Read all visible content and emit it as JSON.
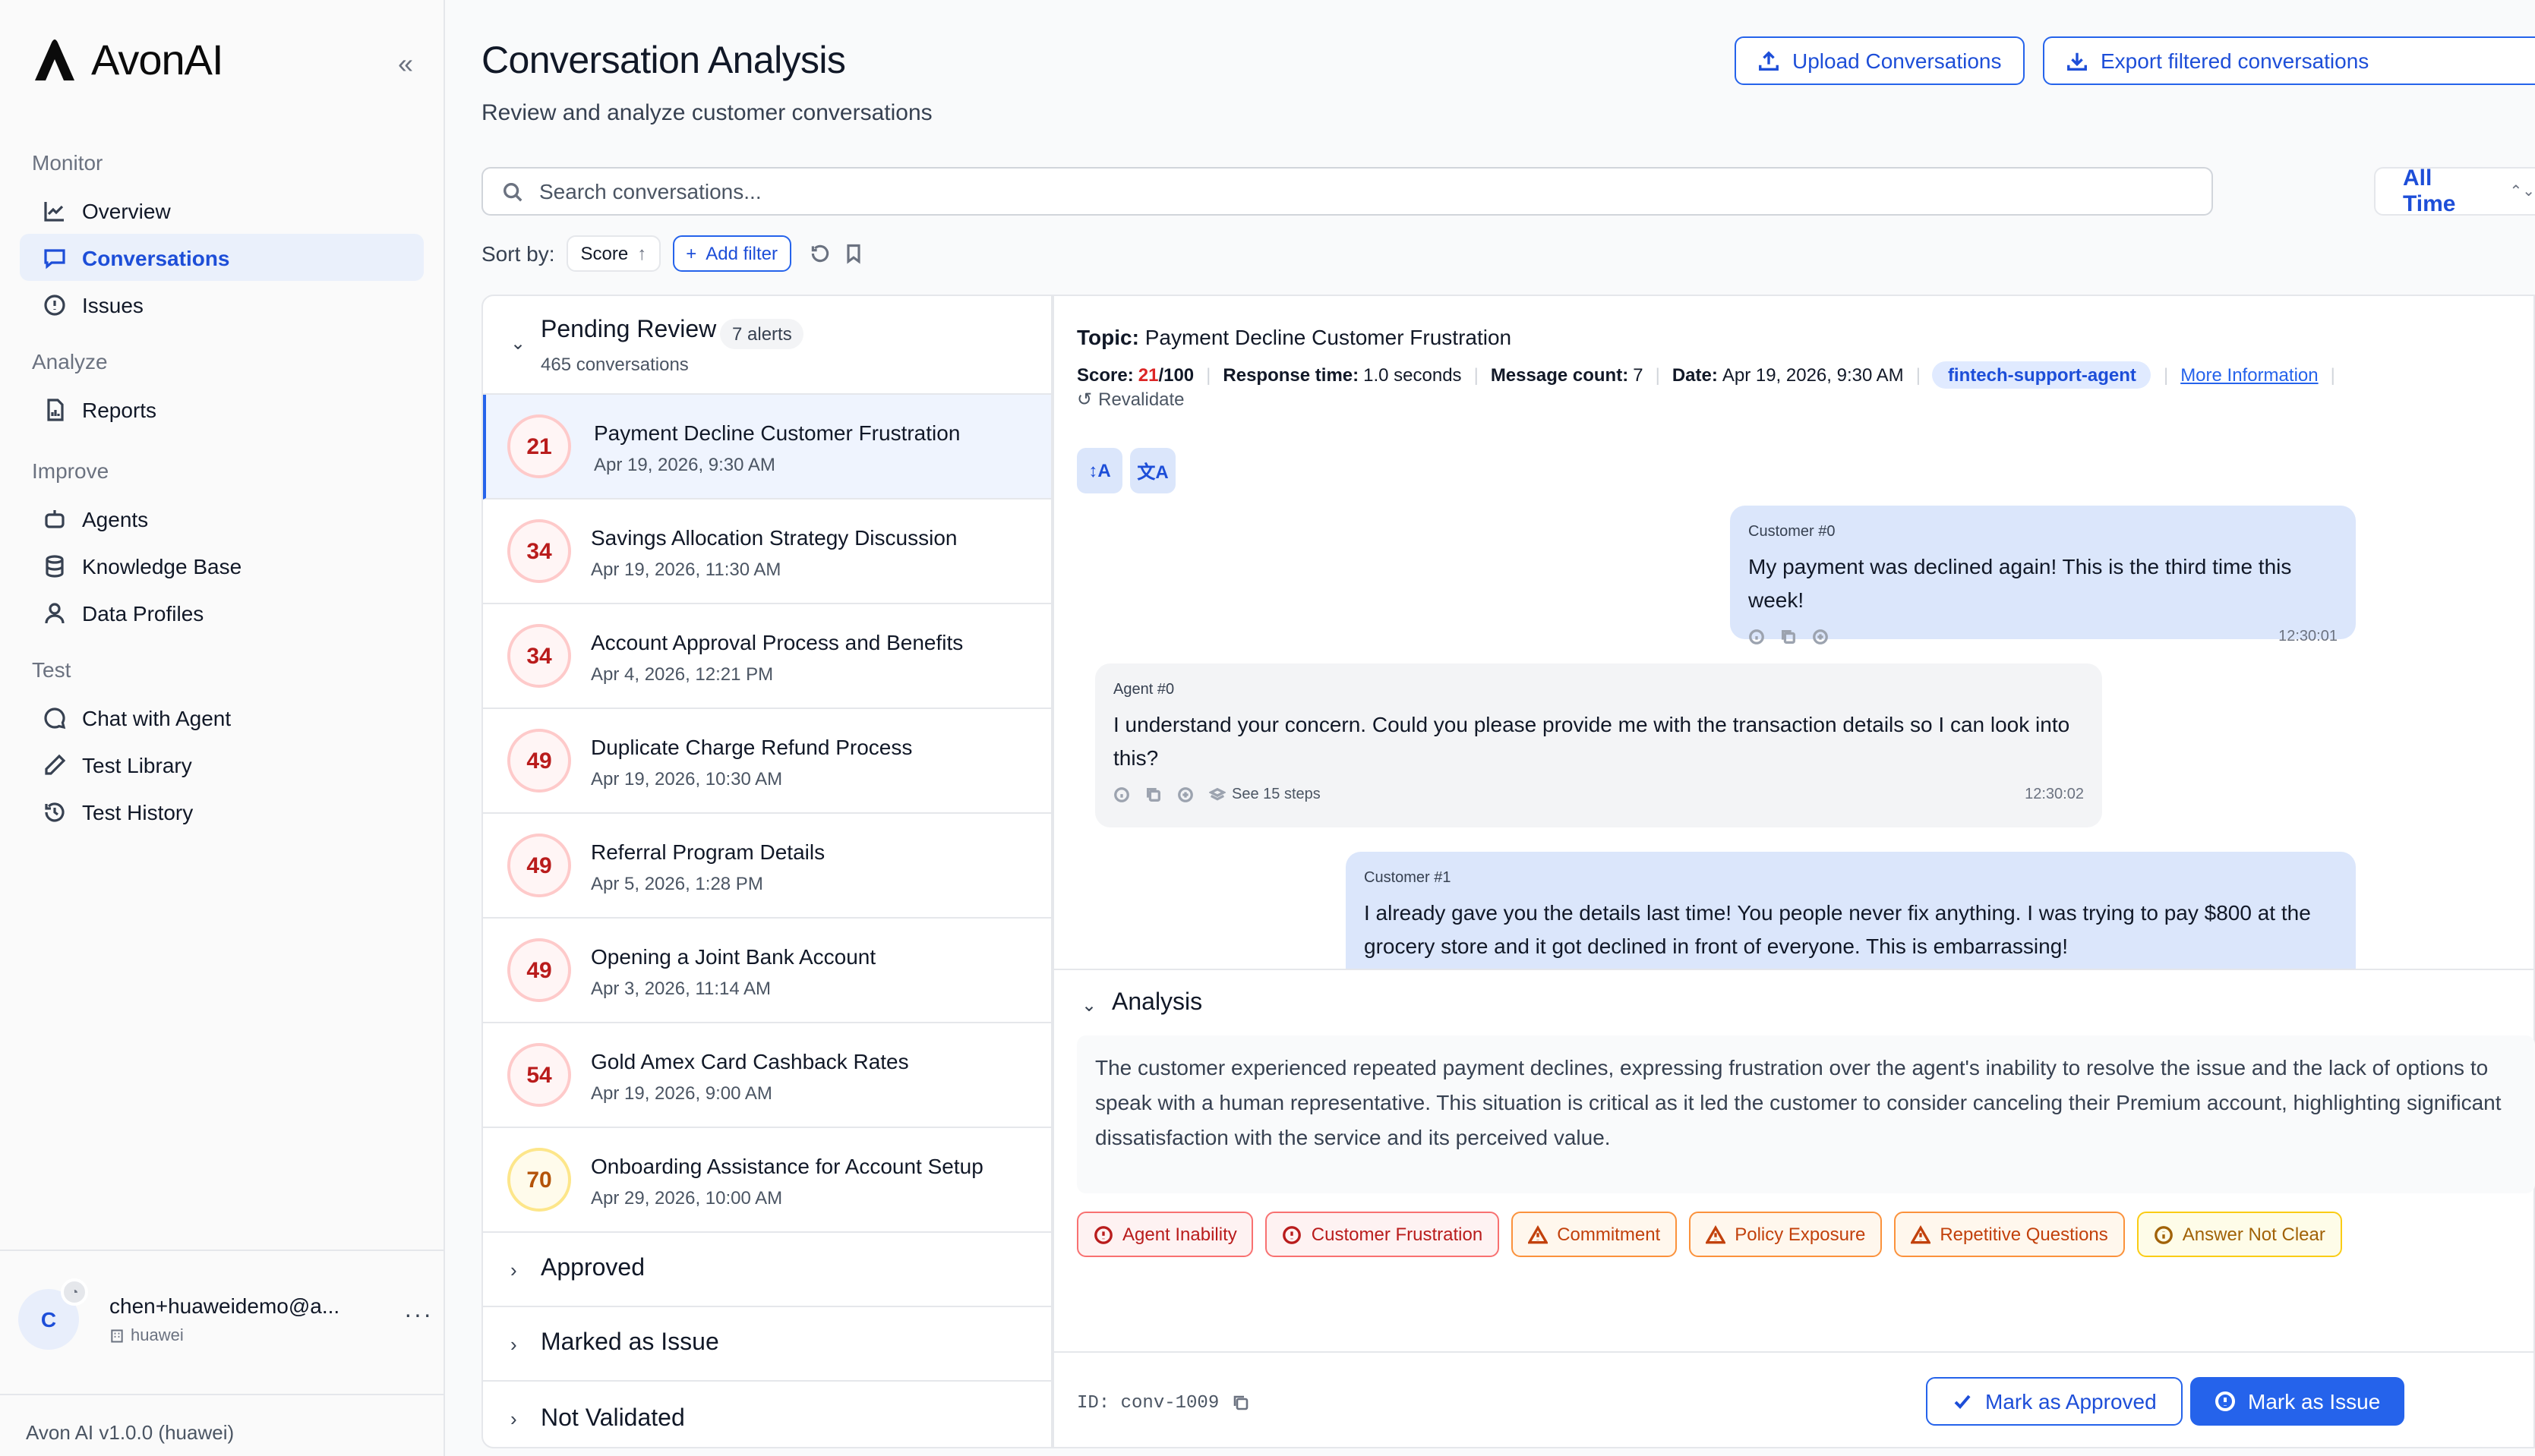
{
  "brand": {
    "name": "AvonAI"
  },
  "sidebar": {
    "sections": [
      {
        "heading": "Monitor",
        "items": [
          {
            "label": "Overview",
            "icon": "chart-line-icon",
            "active": false
          },
          {
            "label": "Conversations",
            "icon": "message-square-icon",
            "active": true
          },
          {
            "label": "Issues",
            "icon": "alert-circle-icon",
            "active": false
          }
        ]
      },
      {
        "heading": "Analyze",
        "items": [
          {
            "label": "Reports",
            "icon": "file-chart-icon",
            "active": false
          }
        ]
      },
      {
        "heading": "Improve",
        "items": [
          {
            "label": "Agents",
            "icon": "bot-icon",
            "active": false
          },
          {
            "label": "Knowledge Base",
            "icon": "database-icon",
            "active": false
          },
          {
            "label": "Data Profiles",
            "icon": "user-icon",
            "active": false
          }
        ]
      },
      {
        "heading": "Test",
        "items": [
          {
            "label": "Chat with Agent",
            "icon": "chat-bubble-icon",
            "active": false
          },
          {
            "label": "Test Library",
            "icon": "pencil-icon",
            "active": false
          },
          {
            "label": "Test History",
            "icon": "history-icon",
            "active": false
          }
        ]
      }
    ],
    "user": {
      "initial": "C",
      "email": "chen+huaweidemo@a...",
      "org": "huawei"
    },
    "version": "Avon AI v1.0.0 (huawei)"
  },
  "header": {
    "title": "Conversation Analysis",
    "subtitle": "Review and analyze customer conversations",
    "upload_label": "Upload Conversations",
    "export_label": "Export filtered conversations"
  },
  "search": {
    "placeholder": "Search conversations...",
    "value": ""
  },
  "time_filter": {
    "selected": "All Time"
  },
  "sort": {
    "label": "Sort by:",
    "field": "Score",
    "add_filter_label": "Add filter"
  },
  "list": {
    "pending": {
      "title": "Pending Review",
      "alerts": "7 alerts",
      "count": "465 conversations"
    },
    "rows": [
      {
        "score": "21",
        "title": "Payment Decline Customer Frustration",
        "date": "Apr 19, 2026, 9:30 AM",
        "tone": "red",
        "selected": true
      },
      {
        "score": "34",
        "title": "Savings Allocation Strategy Discussion",
        "date": "Apr 19, 2026, 11:30 AM",
        "tone": "red",
        "selected": false
      },
      {
        "score": "34",
        "title": "Account Approval Process and Benefits",
        "date": "Apr 4, 2026, 12:21 PM",
        "tone": "red",
        "selected": false
      },
      {
        "score": "49",
        "title": "Duplicate Charge Refund Process",
        "date": "Apr 19, 2026, 10:30 AM",
        "tone": "red",
        "selected": false
      },
      {
        "score": "49",
        "title": "Referral Program Details",
        "date": "Apr 5, 2026, 1:28 PM",
        "tone": "red",
        "selected": false
      },
      {
        "score": "49",
        "title": "Opening a Joint Bank Account",
        "date": "Apr 3, 2026, 11:14 AM",
        "tone": "red",
        "selected": false
      },
      {
        "score": "54",
        "title": "Gold Amex Card Cashback Rates",
        "date": "Apr 19, 2026, 9:00 AM",
        "tone": "red",
        "selected": false
      },
      {
        "score": "70",
        "title": "Onboarding Assistance for Account Setup",
        "date": "Apr 29, 2026, 10:00 AM",
        "tone": "amber",
        "selected": false
      }
    ],
    "other_groups": [
      "Approved",
      "Marked as Issue",
      "Not Validated"
    ]
  },
  "detail": {
    "topic_label": "Topic:",
    "topic": "Payment Decline Customer Frustration",
    "score_label": "Score:",
    "score_value": "21",
    "score_total": "/100",
    "response_label": "Response time:",
    "response_value": "1.0 seconds",
    "messages_label": "Message count:",
    "messages_value": "7",
    "date_label": "Date:",
    "date_value": "Apr 19, 2026, 9:30 AM",
    "agent_tag": "fintech-support-agent",
    "more_info": "More Information",
    "revalidate": "Revalidate",
    "messages": [
      {
        "role": "customer",
        "who": "Customer #0",
        "text": "My payment was declined again! This is the third time this week!",
        "time": "12:30:01",
        "steps": ""
      },
      {
        "role": "agent",
        "who": "Agent #0",
        "text": "I understand your concern. Could you please provide me with the transaction details so I can look into this?",
        "time": "12:30:02",
        "steps": "See 15 steps"
      },
      {
        "role": "customer",
        "who": "Customer #1",
        "text": "I already gave you the details last time! You people never fix anything. I was trying to pay $800 at the grocery store and it got declined in front of everyone. This is embarrassing!",
        "time": "",
        "steps": ""
      }
    ],
    "analysis_title": "Analysis",
    "analysis_text": "The customer experienced repeated payment declines, expressing frustration over the agent's inability to resolve the issue and the lack of options to speak with a human representative. This situation is critical as it led the customer to consider canceling their Premium account, highlighting significant dissatisfaction with the service and its perceived value.",
    "tags": [
      {
        "label": "Agent Inability",
        "tone": "red",
        "icon": "alert-circle-icon"
      },
      {
        "label": "Customer Frustration",
        "tone": "red",
        "icon": "alert-circle-icon"
      },
      {
        "label": "Commitment",
        "tone": "orange",
        "icon": "warning-triangle-icon"
      },
      {
        "label": "Policy Exposure",
        "tone": "orange",
        "icon": "warning-triangle-icon"
      },
      {
        "label": "Repetitive Questions",
        "tone": "orange",
        "icon": "warning-triangle-icon"
      },
      {
        "label": "Answer Not Clear",
        "tone": "yellow",
        "icon": "info-circle-icon"
      }
    ],
    "conversation_id": "ID: conv-1009",
    "approve_label": "Mark as Approved",
    "issue_label": "Mark as Issue"
  },
  "colors": {
    "accent": "#2563eb",
    "active_bg": "#eaf0fb",
    "danger": "#dc2626"
  }
}
